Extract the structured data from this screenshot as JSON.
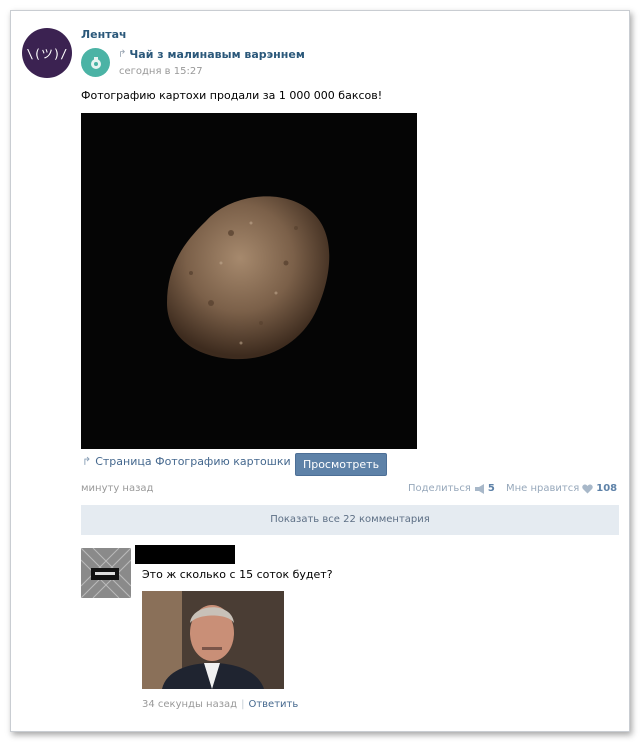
{
  "post": {
    "author": "Лентач",
    "avatar_glyph": "\\(ツ)/",
    "repost_source": "Чай з малинавым варэннем",
    "repost_time": "сегодня в 15:27",
    "text": "Фотографию картохи продали за 1 000 000 баксов!",
    "photo_icon": "potato-photo",
    "attachment_label": "Страница Фотографию картошки п..",
    "view_button": "Просмотреть",
    "time": "минуту назад",
    "share_label": "Поделиться",
    "share_count": "5",
    "like_label": "Мне нравится",
    "like_count": "108"
  },
  "comments_toggle": "Показать все 22 комментария",
  "comment": {
    "text": "Это ж сколько с 15 соток будет?",
    "time": "34 секунды назад",
    "separator": "|",
    "reply_label": "Ответить"
  },
  "colors": {
    "link": "#2b587a",
    "button": "#5e82a8",
    "panel": "#e5ebf1",
    "meta": "#999999"
  }
}
